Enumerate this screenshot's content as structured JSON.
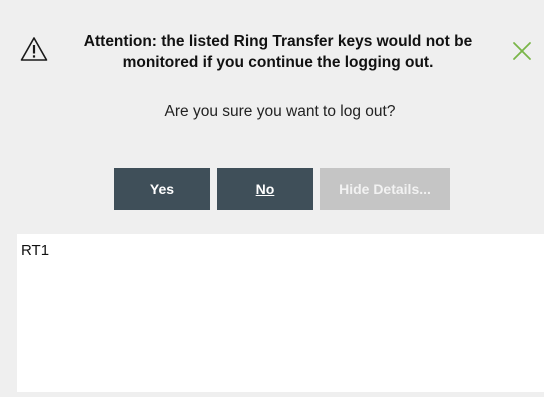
{
  "dialog": {
    "title": "Attention: the listed Ring Transfer keys would not be monitored if you continue the logging out.",
    "question": "Are you sure you want to log out?",
    "icons": {
      "warning": "warning-triangle-icon",
      "close": "close-x-icon"
    },
    "colors": {
      "close_icon": "#7ab648",
      "primary_button": "#3f4f59",
      "disabled_button": "#c5c5c5"
    }
  },
  "buttons": {
    "yes_label": "Yes",
    "no_label": "No",
    "hide_details_label": "Hide Details..."
  },
  "details": {
    "items": [
      "RT1"
    ]
  }
}
